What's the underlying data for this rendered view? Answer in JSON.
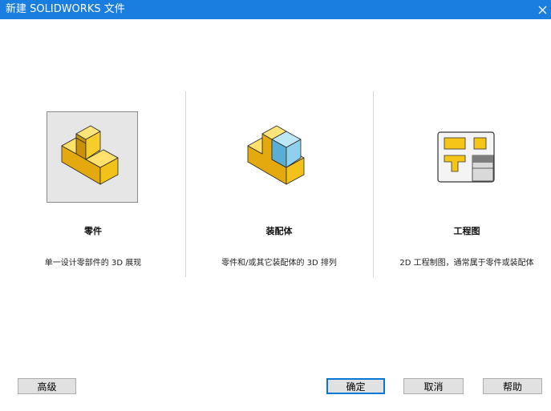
{
  "window": {
    "title": "新建 SOLIDWORKS 文件",
    "close_glyph": "✕"
  },
  "panels": [
    {
      "label": "零件",
      "description": "单一设计零部件的 3D 展现",
      "icon": "part-icon",
      "selected": true
    },
    {
      "label": "装配体",
      "description": "零件和/或其它装配体的 3D 排列",
      "icon": "assembly-icon",
      "selected": false
    },
    {
      "label": "工程图",
      "description": "2D 工程制图，通常属于零件或装配体",
      "icon": "drawing-icon",
      "selected": false
    }
  ],
  "buttons": {
    "advanced": "高级",
    "ok": "确定",
    "cancel": "取消",
    "help": "帮助"
  },
  "colors": {
    "titlebar": "#1a7de0",
    "part_yellow": "#f5c518",
    "assembly_blue": "#8fd0ee",
    "selection_bg": "#e6e6e6"
  }
}
